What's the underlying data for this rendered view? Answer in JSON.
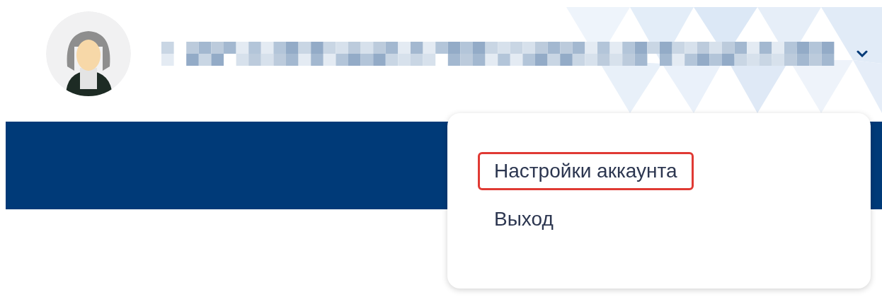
{
  "header": {
    "user_menu": {
      "expanded": true
    }
  },
  "dropdown": {
    "items": [
      {
        "label": "Настройки аккаунта",
        "highlighted": true
      },
      {
        "label": "Выход",
        "highlighted": false
      }
    ]
  }
}
